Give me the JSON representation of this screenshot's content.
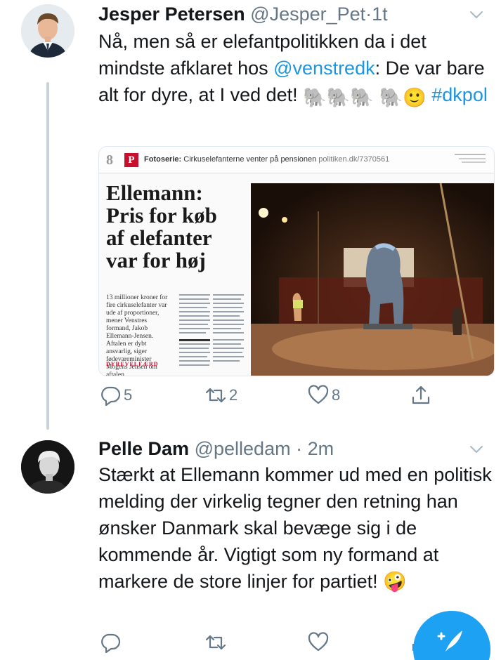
{
  "tweets": [
    {
      "name": "Jesper Petersen",
      "handle": "@Jesper_Pet",
      "time": "1t",
      "text_before_mention": "Nå, men så er elefantpolitikken da i det mindste afklaret hos ",
      "mention": "@venstredk",
      "text_after_mention": ": De var bare alt for dyre, at I ved det! ",
      "emoji_row": "🐘🐘🐘 🐘🙂",
      "hashtag": "#dkpol",
      "media": {
        "page_number": "8",
        "logo_letter": "P",
        "label_bold": "Fotoserie:",
        "label_text": "Cirkuselefanterne venter på pensionen",
        "url": "politiken.dk/7370561",
        "headline": "Ellemann: Pris for køb af elefanter var for høj",
        "lede": "13 millioner kroner for fire cirkuselefanter var ude af proportioner, mener Venstres formand, Jakob Ellemann-Jensen. Aftalen er dybt ansvarlig, siger fødevareminister Mogens Jensen om aftalen.",
        "section": "DYREVELFÆRD"
      },
      "actions": {
        "replies": "5",
        "retweets": "2",
        "likes": "8"
      }
    },
    {
      "name": "Pelle Dam",
      "handle": "@pelledam",
      "time": "2m",
      "text": "Stærkt at Ellemann kommer ud med en politisk melding der virkelig tegner den retning han ønsker Danmark skal bevæge sig i de kommende år. Vigtigt som ny formand at markere de store linjer for partiet! 🤪",
      "actions": {
        "replies": "",
        "retweets": "",
        "likes": ""
      }
    }
  ],
  "separator": "·",
  "colors": {
    "link": "#1b95e0",
    "muted": "#657786",
    "fab": "#1da1f2",
    "thread_line": "#c9d2da"
  },
  "icons": [
    "reply-icon",
    "retweet-icon",
    "like-icon",
    "share-icon",
    "chevron-down-icon",
    "compose-icon"
  ]
}
